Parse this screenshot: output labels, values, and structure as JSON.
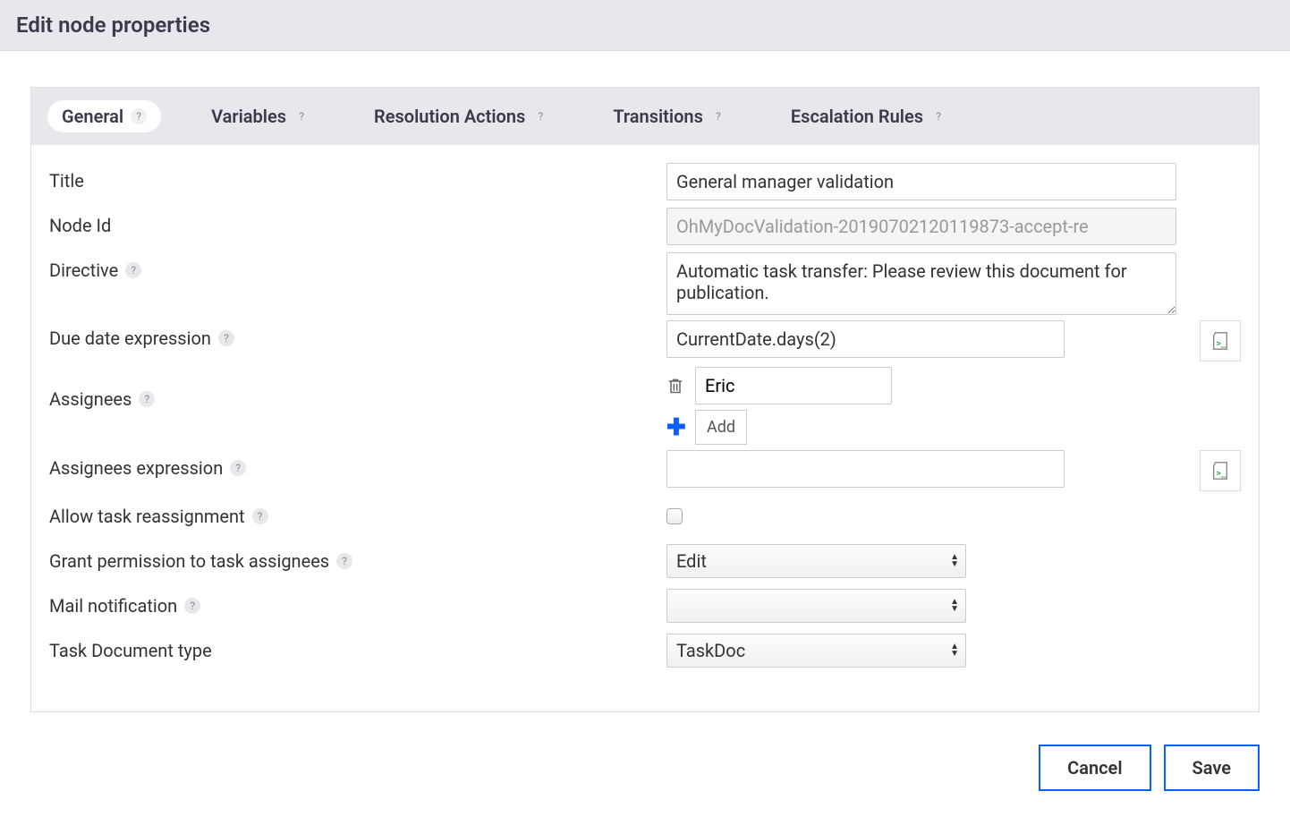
{
  "header": {
    "title": "Edit node properties"
  },
  "tabs": [
    {
      "label": "General",
      "active": true,
      "help": true
    },
    {
      "label": "Variables",
      "active": false,
      "help": true
    },
    {
      "label": "Resolution Actions",
      "active": false,
      "help": true
    },
    {
      "label": "Transitions",
      "active": false,
      "help": true
    },
    {
      "label": "Escalation Rules",
      "active": false,
      "help": true
    }
  ],
  "form": {
    "title": {
      "label": "Title",
      "value": "General manager validation"
    },
    "nodeId": {
      "label": "Node Id",
      "value": "OhMyDocValidation-20190702120119873-accept-re"
    },
    "directive": {
      "label": "Directive",
      "value": "Automatic task transfer: Please review this document for publication."
    },
    "dueDate": {
      "label": "Due date expression",
      "value": "CurrentDate.days(2)"
    },
    "assignees": {
      "label": "Assignees",
      "items": [
        "Eric"
      ],
      "addLabel": "Add"
    },
    "assigneesExpr": {
      "label": "Assignees expression",
      "value": ""
    },
    "allowReassign": {
      "label": "Allow task reassignment",
      "checked": false
    },
    "grantPermission": {
      "label": "Grant permission to task assignees",
      "value": "Edit"
    },
    "mailNotification": {
      "label": "Mail notification",
      "value": ""
    },
    "taskDocType": {
      "label": "Task Document type",
      "value": "TaskDoc"
    }
  },
  "buttons": {
    "cancel": "Cancel",
    "save": "Save"
  },
  "helpSymbol": "?"
}
